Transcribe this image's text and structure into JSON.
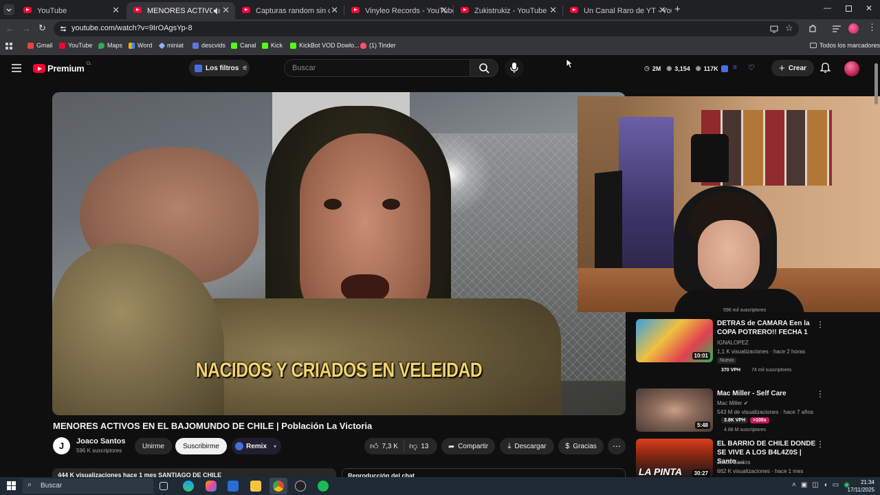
{
  "browser": {
    "tabs": [
      {
        "label": "YouTube",
        "active": false
      },
      {
        "label": "MENORES ACTIVOS EN EL B",
        "active": true
      },
      {
        "label": "Capturas random sin contexto",
        "active": false
      },
      {
        "label": "Vinyleo Records - YouTube",
        "active": false
      },
      {
        "label": "Zukistrukiz - YouTube",
        "active": false
      },
      {
        "label": "Un Canal Raro de YT - YouTube",
        "active": false
      }
    ],
    "url": "youtube.com/watch?v=9IrOAgsYp-8",
    "bookmarks": [
      {
        "label": "Gmail",
        "color": "#ea4335"
      },
      {
        "label": "YouTube",
        "color": "#ff0033"
      },
      {
        "label": "Maps",
        "color": "#34a853"
      },
      {
        "label": "Word",
        "color": "#4285f4"
      },
      {
        "label": "miniat",
        "color": "#8ab4f8"
      },
      {
        "label": "descvids",
        "color": "#5b7bd5"
      },
      {
        "label": "Canal",
        "color": "#53fc18"
      },
      {
        "label": "Kick",
        "color": "#53fc18"
      },
      {
        "label": "KickBot VOD Dowlo...",
        "color": "#53fc18"
      },
      {
        "label": "(1) Tinder",
        "color": "#fd5068"
      }
    ],
    "all_bookmarks": "Todos los marcadores"
  },
  "youtube": {
    "logo_text": "Premium",
    "logo_region": "CL",
    "filters_label": "Los filtros",
    "search_placeholder": "Buscar",
    "stats": {
      "a": "2M",
      "b": "3,154",
      "c": "117K"
    },
    "create_label": "Crear"
  },
  "video": {
    "caption": "NACIDOS Y CRIADOS EN VELEIDAD",
    "title": "MENORES ACTIVOS EN EL BAJOMUNDO DE CHILE | Población La Victoria",
    "channel": "Joaco Santos",
    "channel_initial": "J",
    "subscribers": "596 K suscriptores",
    "join_label": "Unirme",
    "subscribe_label": "Suscribirme",
    "remix_label": "Remix",
    "likes": "7,3 K",
    "dislikes": "13",
    "share_label": "Compartir",
    "download_label": "Descargar",
    "thanks_label": "Gracias",
    "views_line": "444 K visualizaciones  hace 1 mes  SANTIAGO DE CHILE",
    "chat_replay": "Reproducción del chat"
  },
  "recommendations": [
    {
      "title": "DETRAS de CAMARA Een la COPA POTRERO!! FECHA 1",
      "channel": "IGNALOPEZ",
      "meta": "1,1 K visualizaciones · hace 2 horas",
      "badge": "Nuevo",
      "vph": "370 VPH",
      "subs": "74 mil suscriptores",
      "duration": "10:01"
    },
    {
      "title": "Mac Miller - Self Care",
      "channel": "Mac Miller",
      "meta": "543 M de visualizaciones · hace 7 años",
      "vph": "3.8K VPH",
      "ratio": ">100x",
      "subs": "4.88 M suscriptores",
      "duration": "5:48"
    },
    {
      "title": "EL BARRIO DE CHILE DONDE SE VIVE A LOS B4L4Z0S | Santo ...",
      "channel": "Joaco Santos",
      "meta": "662 K visualizaciones · hace 1 mes",
      "duration": "30:27",
      "thumb_text": "LA PINTA"
    }
  ],
  "partial_subs_line": "596 mil suscriptores",
  "taskbar": {
    "search_placeholder": "Buscar",
    "time": "21:34",
    "date": "17/11/2025"
  },
  "colors": {
    "accent": "#ff0033",
    "bg": "#0f0f0f",
    "link": "#3ea6ff"
  }
}
